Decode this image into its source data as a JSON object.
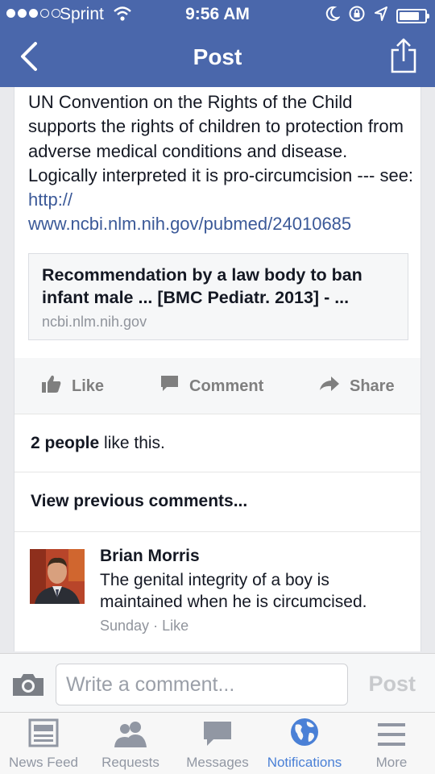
{
  "status_bar": {
    "carrier": "Sprint",
    "time": "9:56 AM"
  },
  "nav": {
    "title": "Post"
  },
  "post": {
    "text_before": "UN Convention on the Rights of the Child supports the rights of children to protection from adverse medical conditions and disease. Logically interpreted it is pro-circumcision --- see: ",
    "link_text": "http://\nwww.ncbi.nlm.nih.gov/pubmed/24010685",
    "link_card": {
      "title": "Recommendation by a law body to ban infant male ... [BMC Pediatr. 2013] - ...",
      "domain": "ncbi.nlm.nih.gov"
    }
  },
  "actions": {
    "like": "Like",
    "comment": "Comment",
    "share": "Share"
  },
  "likes": {
    "count": "2 people",
    "suffix": " like this."
  },
  "view_previous": "View previous comments...",
  "comment": {
    "author": "Brian Morris",
    "text": "The genital integrity of a boy is maintained when he is circumcised.",
    "time": "Sunday",
    "separator": " · ",
    "like": "Like"
  },
  "composer": {
    "placeholder": "Write a comment...",
    "post_label": "Post"
  },
  "tabs": [
    {
      "label": "News Feed",
      "icon": "news-feed-icon"
    },
    {
      "label": "Requests",
      "icon": "requests-icon"
    },
    {
      "label": "Messages",
      "icon": "messages-icon"
    },
    {
      "label": "Notifications",
      "icon": "globe-icon",
      "active": true
    },
    {
      "label": "More",
      "icon": "menu-icon"
    }
  ],
  "colors": {
    "header": "#4a67ab",
    "link": "#3b5998",
    "active_tab": "#4a80d6"
  }
}
